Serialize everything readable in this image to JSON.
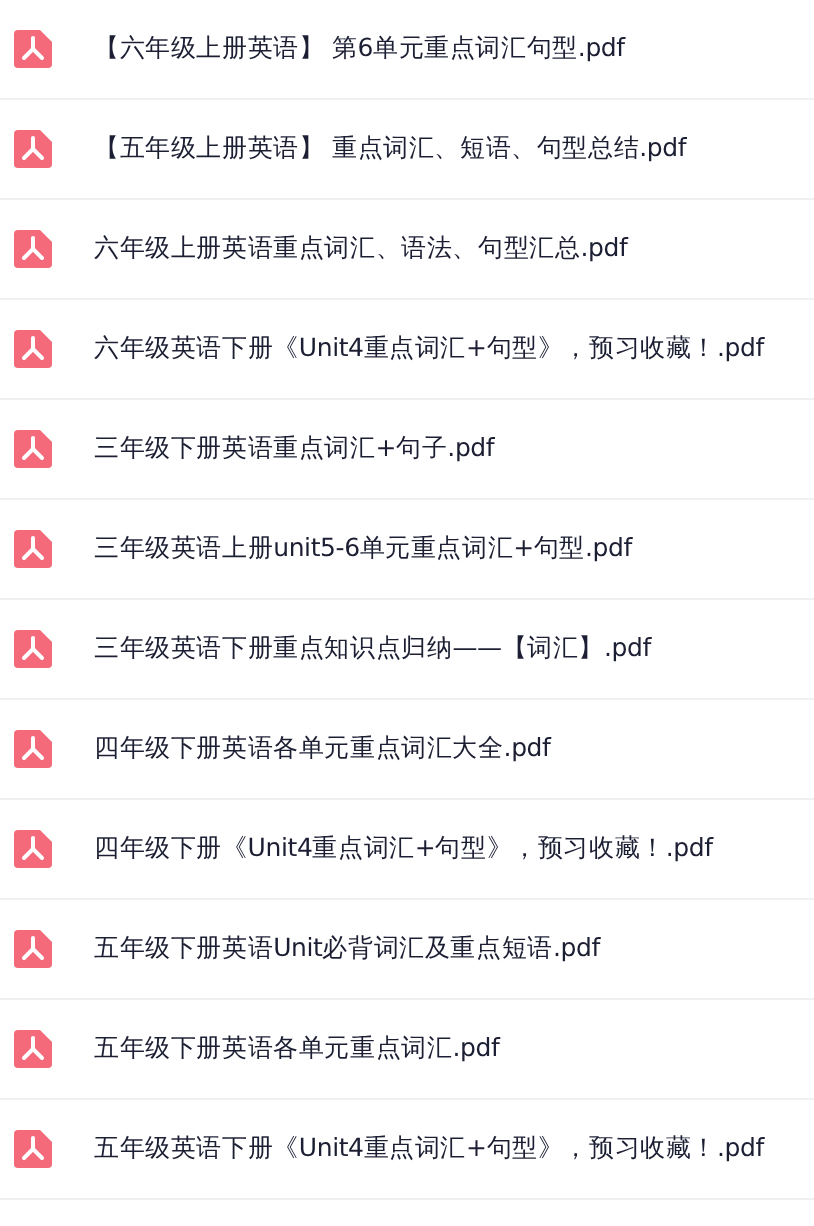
{
  "files": [
    {
      "name": "【六年级上册英语】 第6单元重点词汇句型.pdf"
    },
    {
      "name": "【五年级上册英语】 重点词汇、短语、句型总结.pdf"
    },
    {
      "name": "六年级上册英语重点词汇、语法、句型汇总.pdf"
    },
    {
      "name": "六年级英语下册《Unit4重点词汇+句型》，预习收藏！.pdf"
    },
    {
      "name": "三年级下册英语重点词汇+句子.pdf"
    },
    {
      "name": "三年级英语上册unit5-6单元重点词汇+句型.pdf"
    },
    {
      "name": "三年级英语下册重点知识点归纳——【词汇】.pdf"
    },
    {
      "name": "四年级下册英语各单元重点词汇大全.pdf"
    },
    {
      "name": "四年级下册《Unit4重点词汇+句型》，预习收藏！.pdf"
    },
    {
      "name": "五年级下册英语Unit必背词汇及重点短语.pdf"
    },
    {
      "name": "五年级下册英语各单元重点词汇.pdf"
    },
    {
      "name": "五年级英语下册《Unit4重点词汇+句型》，预习收藏！.pdf"
    }
  ]
}
